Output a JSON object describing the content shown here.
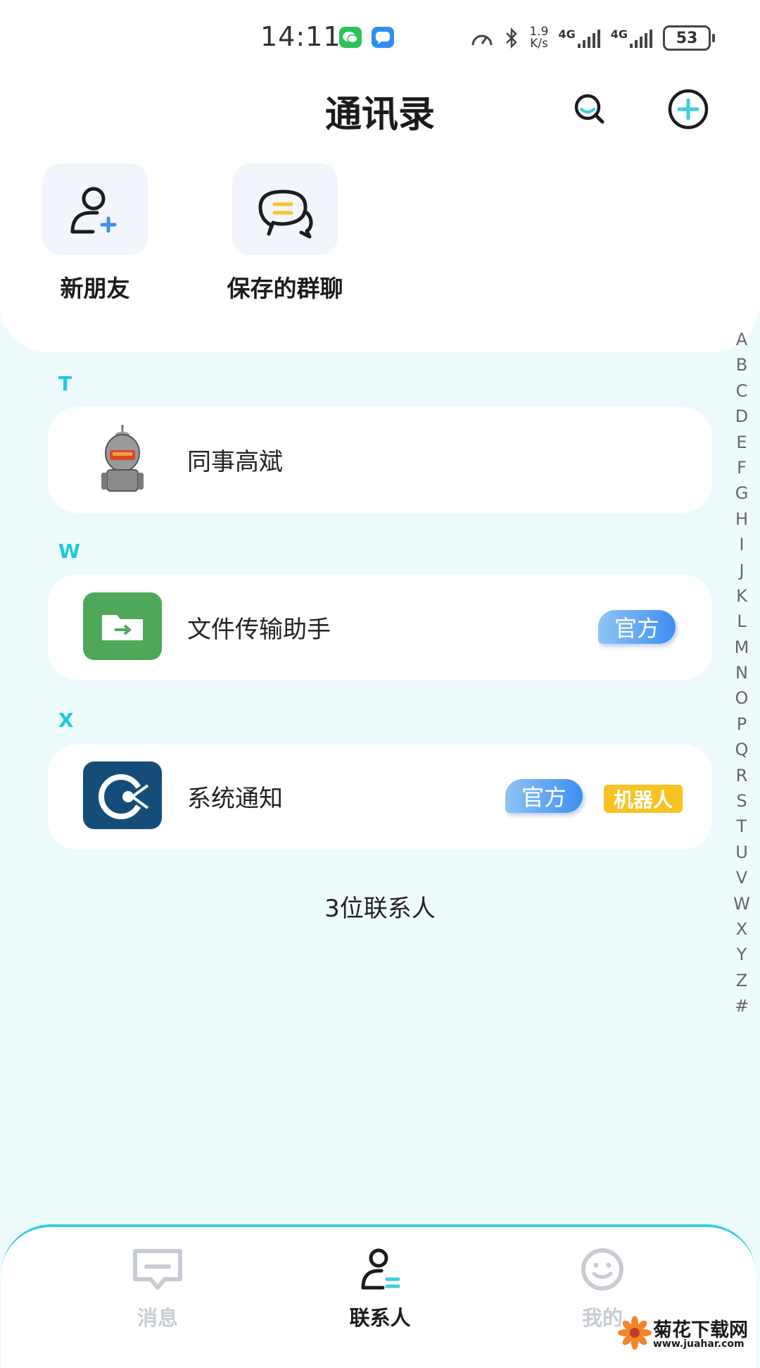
{
  "status_bar": {
    "time": "14:11",
    "net_speed_value": "1.9",
    "net_speed_unit": "K/s",
    "signal_1": "4G",
    "signal_2": "4G",
    "battery": "53"
  },
  "header": {
    "title": "通讯录"
  },
  "quick_actions": [
    {
      "label": "新朋友"
    },
    {
      "label": "保存的群聊"
    }
  ],
  "sections": [
    {
      "letter": "T",
      "contacts": [
        {
          "name": "同事高斌",
          "badges": []
        }
      ]
    },
    {
      "letter": "W",
      "contacts": [
        {
          "name": "文件传输助手",
          "badges": [
            "官方"
          ]
        }
      ]
    },
    {
      "letter": "X",
      "contacts": [
        {
          "name": "系统通知",
          "badges": [
            "官方",
            "机器人"
          ]
        }
      ]
    }
  ],
  "contact_count": "3位联系人",
  "alpha_index": [
    "A",
    "B",
    "C",
    "D",
    "E",
    "F",
    "G",
    "H",
    "I",
    "J",
    "K",
    "L",
    "M",
    "N",
    "O",
    "P",
    "Q",
    "R",
    "S",
    "T",
    "U",
    "V",
    "W",
    "X",
    "Y",
    "Z",
    "#"
  ],
  "tabs": [
    {
      "label": "消息",
      "active": false
    },
    {
      "label": "联系人",
      "active": true
    },
    {
      "label": "我的",
      "active": false
    }
  ],
  "watermark": {
    "text": "菊花下载网",
    "url": "www.juahar.com"
  }
}
